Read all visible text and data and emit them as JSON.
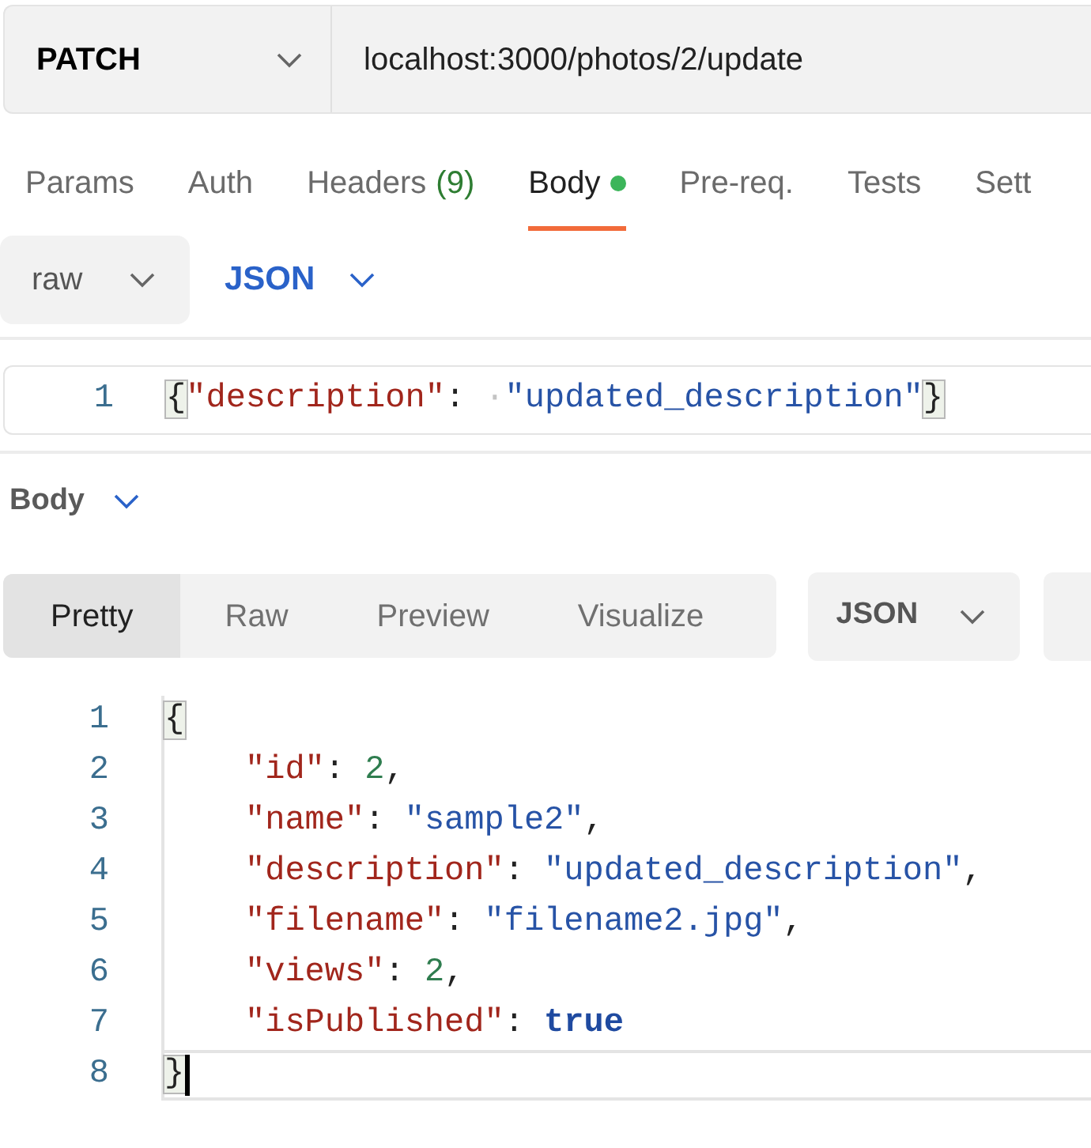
{
  "request": {
    "method": "PATCH",
    "url": "localhost:3000/photos/2/update"
  },
  "tabs": [
    {
      "label": "Params",
      "indicator": false,
      "selected": false
    },
    {
      "label": "Auth",
      "indicator": false,
      "selected": false
    },
    {
      "label": "Headers",
      "count": "(9)",
      "indicator": false,
      "selected": false
    },
    {
      "label": "Body",
      "indicator": true,
      "selected": true
    },
    {
      "label": "Pre-req.",
      "indicator": false,
      "selected": false
    },
    {
      "label": "Tests",
      "indicator": false,
      "selected": false
    },
    {
      "label": "Sett",
      "indicator": false,
      "selected": false
    }
  ],
  "body_mode": {
    "mode": "raw",
    "language": "JSON"
  },
  "request_body": {
    "lines": [
      {
        "number": "1",
        "tokens": [
          {
            "kind": "bracket",
            "text": "{"
          },
          {
            "kind": "key",
            "text": "\"description\""
          },
          {
            "kind": "punct",
            "text": ": "
          },
          {
            "kind": "whitespace",
            "text": "·"
          },
          {
            "kind": "string",
            "text": "\"updated_description\""
          },
          {
            "kind": "bracket",
            "text": "}"
          }
        ]
      }
    ]
  },
  "response": {
    "section_label": "Body",
    "views": [
      {
        "label": "Pretty",
        "selected": true
      },
      {
        "label": "Raw",
        "selected": false
      },
      {
        "label": "Preview",
        "selected": false
      },
      {
        "label": "Visualize",
        "selected": false
      }
    ],
    "format": "JSON",
    "lines": [
      {
        "number": "1",
        "indented": false,
        "active": false,
        "tokens": [
          {
            "kind": "bracket",
            "text": "{"
          }
        ]
      },
      {
        "number": "2",
        "indented": true,
        "active": false,
        "tokens": [
          {
            "kind": "key",
            "text": "\"id\""
          },
          {
            "kind": "punct",
            "text": ": "
          },
          {
            "kind": "number",
            "text": "2"
          },
          {
            "kind": "punct",
            "text": ","
          }
        ]
      },
      {
        "number": "3",
        "indented": true,
        "active": false,
        "tokens": [
          {
            "kind": "key",
            "text": "\"name\""
          },
          {
            "kind": "punct",
            "text": ": "
          },
          {
            "kind": "string",
            "text": "\"sample2\""
          },
          {
            "kind": "punct",
            "text": ","
          }
        ]
      },
      {
        "number": "4",
        "indented": true,
        "active": false,
        "tokens": [
          {
            "kind": "key",
            "text": "\"description\""
          },
          {
            "kind": "punct",
            "text": ": "
          },
          {
            "kind": "string",
            "text": "\"updated_description\""
          },
          {
            "kind": "punct",
            "text": ","
          }
        ]
      },
      {
        "number": "5",
        "indented": true,
        "active": false,
        "tokens": [
          {
            "kind": "key",
            "text": "\"filename\""
          },
          {
            "kind": "punct",
            "text": ": "
          },
          {
            "kind": "string",
            "text": "\"filename2.jpg\""
          },
          {
            "kind": "punct",
            "text": ","
          }
        ]
      },
      {
        "number": "6",
        "indented": true,
        "active": false,
        "tokens": [
          {
            "kind": "key",
            "text": "\"views\""
          },
          {
            "kind": "punct",
            "text": ": "
          },
          {
            "kind": "number",
            "text": "2"
          },
          {
            "kind": "punct",
            "text": ","
          }
        ]
      },
      {
        "number": "7",
        "indented": true,
        "active": false,
        "tokens": [
          {
            "kind": "key",
            "text": "\"isPublished\""
          },
          {
            "kind": "punct",
            "text": ": "
          },
          {
            "kind": "bool",
            "text": "true"
          }
        ]
      },
      {
        "number": "8",
        "indented": false,
        "active": true,
        "tokens": [
          {
            "kind": "bracket",
            "text": "}"
          }
        ]
      }
    ]
  }
}
